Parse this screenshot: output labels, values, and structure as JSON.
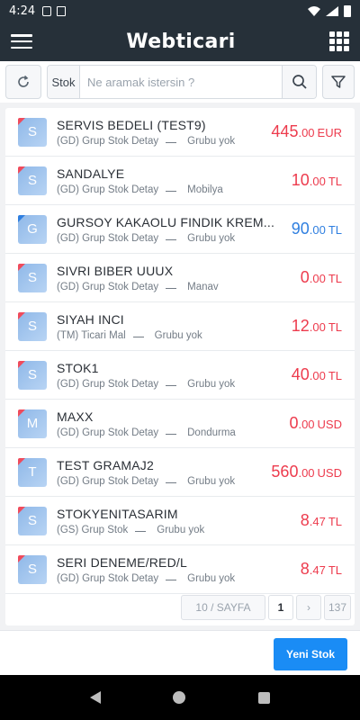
{
  "status_bar": {
    "time": "4:24"
  },
  "app": {
    "logo": "Webticari"
  },
  "search": {
    "prefix": "Stok",
    "placeholder": "Ne aramak istersin ?",
    "value": ""
  },
  "items": [
    {
      "initial": "S",
      "name": "SERVIS BEDELI (TEST9)",
      "type": "(GD) Grup Stok Detay",
      "group": "Grubu yok",
      "price_int": "445",
      "price_dec": ".00",
      "currency": "EUR",
      "accent": "red"
    },
    {
      "initial": "S",
      "name": "SANDALYE",
      "type": "(GD) Grup Stok Detay",
      "group": "Mobilya",
      "price_int": "10",
      "price_dec": ".00",
      "currency": "TL",
      "accent": "red"
    },
    {
      "initial": "G",
      "name": "GURSOY KAKAOLU FINDIK KREM...",
      "type": "(GD) Grup Stok Detay",
      "group": "Grubu yok",
      "price_int": "90",
      "price_dec": ".00",
      "currency": "TL",
      "accent": "blue"
    },
    {
      "initial": "S",
      "name": "SIVRI BIBER UUUX",
      "type": "(GD) Grup Stok Detay",
      "group": "Manav",
      "price_int": "0",
      "price_dec": ".00",
      "currency": "TL",
      "accent": "red"
    },
    {
      "initial": "S",
      "name": "SIYAH INCI",
      "type": "(TM) Ticari Mal",
      "group": "Grubu yok",
      "price_int": "12",
      "price_dec": ".00",
      "currency": "TL",
      "accent": "red"
    },
    {
      "initial": "S",
      "name": "STOK1",
      "type": "(GD) Grup Stok Detay",
      "group": "Grubu yok",
      "price_int": "40",
      "price_dec": ".00",
      "currency": "TL",
      "accent": "red"
    },
    {
      "initial": "M",
      "name": "MAXX",
      "type": "(GD) Grup Stok Detay",
      "group": "Dondurma",
      "price_int": "0",
      "price_dec": ".00",
      "currency": "USD",
      "accent": "red"
    },
    {
      "initial": "T",
      "name": "TEST GRAMAJ2",
      "type": "(GD) Grup Stok Detay",
      "group": "Grubu yok",
      "price_int": "560",
      "price_dec": ".00",
      "currency": "USD",
      "accent": "red"
    },
    {
      "initial": "S",
      "name": "STOKYENITASARIM",
      "type": "(GS) Grup Stok",
      "group": "Grubu yok",
      "price_int": "8",
      "price_dec": ".47",
      "currency": "TL",
      "accent": "red"
    },
    {
      "initial": "S",
      "name": "SERI DENEME/RED/L",
      "type": "(GD) Grup Stok Detay",
      "group": "Grubu yok",
      "price_int": "8",
      "price_dec": ".47",
      "currency": "TL",
      "accent": "red"
    }
  ],
  "pagination": {
    "page_size": "10 / SAYFA",
    "current": "1",
    "next": "›",
    "last": "137"
  },
  "actions": {
    "new_stock": "Yeni Stok"
  },
  "colors": {
    "header": "#263039",
    "price_red": "#ed3b4d",
    "price_blue": "#2f7fe0",
    "primary": "#1a8cf5"
  }
}
